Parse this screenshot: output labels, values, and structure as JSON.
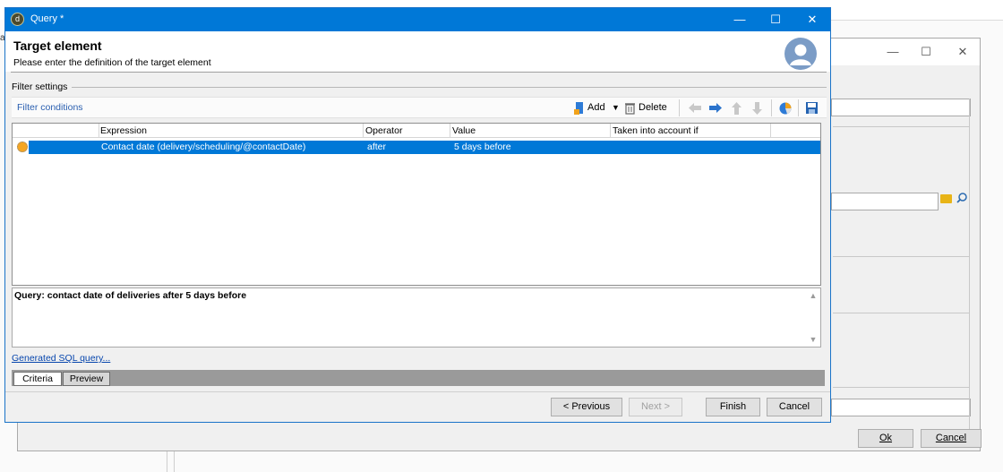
{
  "background": {
    "small_text": "a"
  },
  "dialog2": {
    "minimize_glyph": "—",
    "maximize_glyph": "☐",
    "close_glyph": "✕",
    "ok_label": "Ok",
    "cancel_label": "Cancel"
  },
  "dialog": {
    "title": "Query *",
    "app_icon_glyph": "d",
    "minimize_glyph": "—",
    "maximize_glyph": "☐",
    "close_glyph": "✕",
    "header_title": "Target element",
    "header_subtitle": "Please enter the definition of the target element",
    "filter_settings_label": "Filter settings",
    "toolbar": {
      "filter_conditions_label": "Filter conditions",
      "add_label": "Add",
      "delete_label": "Delete"
    },
    "grid": {
      "columns": [
        "Expression",
        "Operator",
        "Value",
        "Taken into account if"
      ],
      "rows": [
        {
          "expression": "Contact date (delivery/scheduling/@contactDate)",
          "operator": "after",
          "value": "5 days before",
          "taken_into_account_if": ""
        }
      ]
    },
    "query_text": "Query: contact date of deliveries after 5 days before",
    "sql_link": "Generated SQL query...",
    "tabs": [
      {
        "label": "Criteria",
        "active": true
      },
      {
        "label": "Preview",
        "active": false
      }
    ],
    "buttons": {
      "previous": "< Previous",
      "next": "Next >",
      "finish": "Finish",
      "cancel": "Cancel"
    }
  },
  "colors": {
    "titlebar": "#0078d7",
    "selection": "#0078d7",
    "link": "#0645ad",
    "bullet": "#f5a623"
  }
}
